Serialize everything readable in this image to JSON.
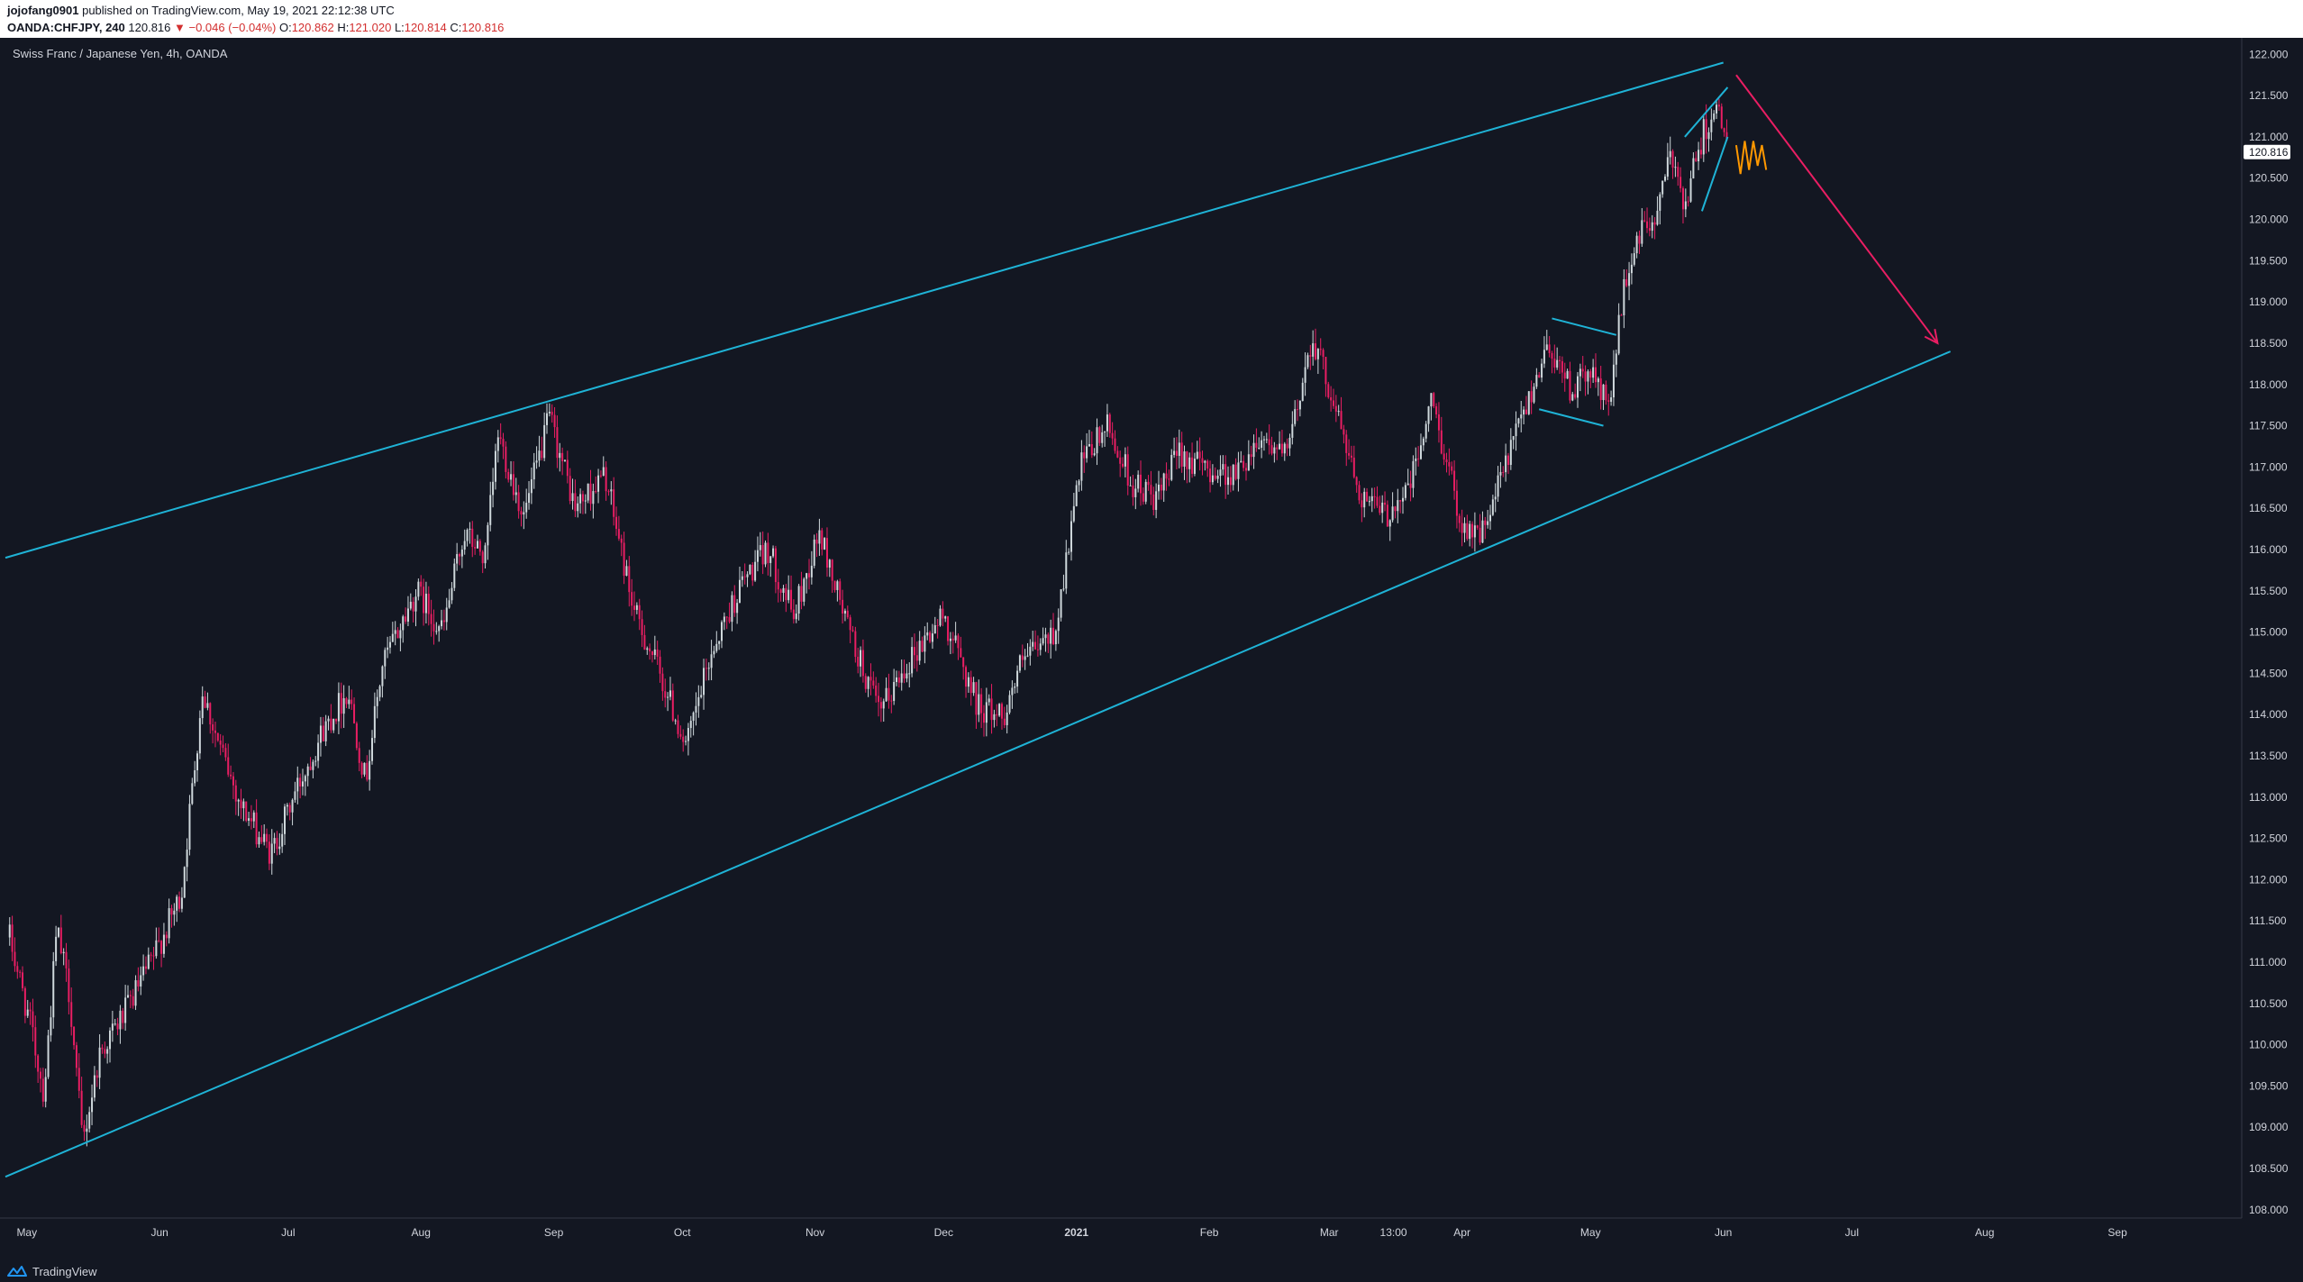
{
  "header": {
    "author": "jojofang0901",
    "published_text": "published on TradingView.com, May 19, 2021 22:12:38 UTC",
    "symbol_tf": "OANDA:CHFJPY, 240",
    "last_price": "120.816",
    "change": "▼ −0.046 (−0.04%)",
    "o_label": "O:",
    "o_value": "120.862",
    "h_label": "H:",
    "h_value": "121.020",
    "l_label": "L:",
    "l_value": "120.814",
    "c_label": "C:",
    "c_value": "120.816"
  },
  "footer": {
    "brand": "TradingView"
  },
  "colors": {
    "background": "#131722",
    "up_candle": "#cfd8dc",
    "down_candle": "#e91e63",
    "channel_line": "#1fb3d6",
    "arrow": "#e91e63",
    "projection": "#ff9800",
    "price_tag_bg": "#ffffff"
  },
  "chart_data": {
    "type": "candlestick",
    "title": "Swiss Franc / Japanese Yen, 4h, OANDA",
    "ylabel_side": "right",
    "ylim": [
      107.9,
      122.2
    ],
    "y_ticks": [
      "108.000",
      "108.500",
      "109.000",
      "109.500",
      "110.000",
      "110.500",
      "111.000",
      "111.500",
      "112.000",
      "112.500",
      "113.000",
      "113.500",
      "114.000",
      "114.500",
      "115.000",
      "115.500",
      "116.000",
      "116.500",
      "117.000",
      "117.500",
      "118.000",
      "118.500",
      "119.000",
      "119.500",
      "120.000",
      "120.500",
      "121.000",
      "121.500",
      "122.000"
    ],
    "current_price": "120.816",
    "x_tick_labels": [
      "May",
      "Jun",
      "Jul",
      "Aug",
      "Sep",
      "Oct",
      "Nov",
      "Dec",
      "2021",
      "Feb",
      "Mar",
      "13:00",
      "Apr",
      "May",
      "Jun",
      "Jul",
      "Aug",
      "Sep"
    ],
    "price_path": [
      {
        "date": "2020-04-27",
        "price": 111.3
      },
      {
        "date": "2020-05-02",
        "price": 110.2
      },
      {
        "date": "2020-05-05",
        "price": 109.4
      },
      {
        "date": "2020-05-08",
        "price": 111.4
      },
      {
        "date": "2020-05-11",
        "price": 110.6
      },
      {
        "date": "2020-05-14",
        "price": 108.8
      },
      {
        "date": "2020-05-18",
        "price": 109.9
      },
      {
        "date": "2020-05-24",
        "price": 110.4
      },
      {
        "date": "2020-05-30",
        "price": 111.0
      },
      {
        "date": "2020-06-06",
        "price": 111.8
      },
      {
        "date": "2020-06-11",
        "price": 114.3
      },
      {
        "date": "2020-06-15",
        "price": 113.6
      },
      {
        "date": "2020-06-20",
        "price": 112.9
      },
      {
        "date": "2020-06-27",
        "price": 112.3
      },
      {
        "date": "2020-07-03",
        "price": 113.1
      },
      {
        "date": "2020-07-09",
        "price": 113.8
      },
      {
        "date": "2020-07-15",
        "price": 114.3
      },
      {
        "date": "2020-07-19",
        "price": 113.2
      },
      {
        "date": "2020-07-23",
        "price": 114.6
      },
      {
        "date": "2020-07-31",
        "price": 115.5
      },
      {
        "date": "2020-08-06",
        "price": 115.0
      },
      {
        "date": "2020-08-11",
        "price": 116.2
      },
      {
        "date": "2020-08-16",
        "price": 115.9
      },
      {
        "date": "2020-08-19",
        "price": 117.4
      },
      {
        "date": "2020-08-25",
        "price": 116.4
      },
      {
        "date": "2020-08-31",
        "price": 117.6
      },
      {
        "date": "2020-09-06",
        "price": 116.5
      },
      {
        "date": "2020-09-13",
        "price": 116.9
      },
      {
        "date": "2020-09-20",
        "price": 115.2
      },
      {
        "date": "2020-09-25",
        "price": 114.6
      },
      {
        "date": "2020-10-02",
        "price": 113.6
      },
      {
        "date": "2020-10-08",
        "price": 114.8
      },
      {
        "date": "2020-10-15",
        "price": 115.6
      },
      {
        "date": "2020-10-21",
        "price": 116.0
      },
      {
        "date": "2020-10-27",
        "price": 115.2
      },
      {
        "date": "2020-11-02",
        "price": 116.2
      },
      {
        "date": "2020-11-09",
        "price": 115.0
      },
      {
        "date": "2020-11-16",
        "price": 114.0
      },
      {
        "date": "2020-11-22",
        "price": 114.6
      },
      {
        "date": "2020-12-01",
        "price": 115.2
      },
      {
        "date": "2020-12-09",
        "price": 114.1
      },
      {
        "date": "2020-12-15",
        "price": 114.0
      },
      {
        "date": "2020-12-19",
        "price": 114.6
      },
      {
        "date": "2020-12-27",
        "price": 115.0
      },
      {
        "date": "2021-01-02",
        "price": 117.0
      },
      {
        "date": "2021-01-08",
        "price": 117.5
      },
      {
        "date": "2021-01-14",
        "price": 116.8
      },
      {
        "date": "2021-01-20",
        "price": 116.6
      },
      {
        "date": "2021-01-25",
        "price": 117.2
      },
      {
        "date": "2021-01-30",
        "price": 117.0
      },
      {
        "date": "2021-02-07",
        "price": 116.9
      },
      {
        "date": "2021-02-13",
        "price": 117.4
      },
      {
        "date": "2021-02-19",
        "price": 117.1
      },
      {
        "date": "2021-02-25",
        "price": 118.6
      },
      {
        "date": "2021-03-02",
        "price": 117.8
      },
      {
        "date": "2021-03-08",
        "price": 116.7
      },
      {
        "date": "2021-03-14",
        "price": 116.4
      },
      {
        "date": "2021-03-20",
        "price": 116.8
      },
      {
        "date": "2021-03-25",
        "price": 117.8
      },
      {
        "date": "2021-04-01",
        "price": 116.3
      },
      {
        "date": "2021-04-06",
        "price": 116.2
      },
      {
        "date": "2021-04-11",
        "price": 117.0
      },
      {
        "date": "2021-04-17",
        "price": 117.9
      },
      {
        "date": "2021-04-21",
        "price": 118.5
      },
      {
        "date": "2021-04-27",
        "price": 117.9
      },
      {
        "date": "2021-05-01",
        "price": 118.2
      },
      {
        "date": "2021-05-05",
        "price": 117.7
      },
      {
        "date": "2021-05-09",
        "price": 119.2
      },
      {
        "date": "2021-05-12",
        "price": 119.8
      },
      {
        "date": "2021-05-16",
        "price": 120.0
      },
      {
        "date": "2021-05-20",
        "price": 120.8
      },
      {
        "date": "2021-05-23",
        "price": 120.2
      },
      {
        "date": "2021-05-27",
        "price": 121.0
      },
      {
        "date": "2021-05-30",
        "price": 121.4
      },
      {
        "date": "2021-06-02",
        "price": 120.816
      }
    ],
    "drawings": {
      "channel_upper": [
        {
          "date": "2020-04-26",
          "price": 115.9
        },
        {
          "date": "2021-06-01",
          "price": 121.9
        }
      ],
      "channel_lower": [
        {
          "date": "2020-04-26",
          "price": 108.4
        },
        {
          "date": "2021-07-24",
          "price": 118.4
        }
      ],
      "pennant_upper": [
        {
          "date": "2021-04-22",
          "price": 118.8
        },
        {
          "date": "2021-05-07",
          "price": 118.6
        }
      ],
      "pennant_lower": [
        {
          "date": "2021-04-19",
          "price": 117.7
        },
        {
          "date": "2021-05-04",
          "price": 117.5
        }
      ],
      "wedge_upper": [
        {
          "date": "2021-05-23",
          "price": 121.0
        },
        {
          "date": "2021-06-02",
          "price": 121.6
        }
      ],
      "wedge_lower": [
        {
          "date": "2021-05-27",
          "price": 120.1
        },
        {
          "date": "2021-06-02",
          "price": 121.0
        }
      ],
      "arrow": [
        {
          "date": "2021-06-04",
          "price": 121.75
        },
        {
          "date": "2021-07-21",
          "price": 118.5
        }
      ],
      "projection": [
        {
          "date": "2021-06-04",
          "price": 120.9
        },
        {
          "date": "2021-06-05",
          "price": 120.55
        },
        {
          "date": "2021-06-06",
          "price": 120.95
        },
        {
          "date": "2021-06-07",
          "price": 120.6
        },
        {
          "date": "2021-06-08",
          "price": 120.95
        },
        {
          "date": "2021-06-09",
          "price": 120.65
        },
        {
          "date": "2021-06-10",
          "price": 120.9
        },
        {
          "date": "2021-06-11",
          "price": 120.6
        }
      ]
    }
  }
}
